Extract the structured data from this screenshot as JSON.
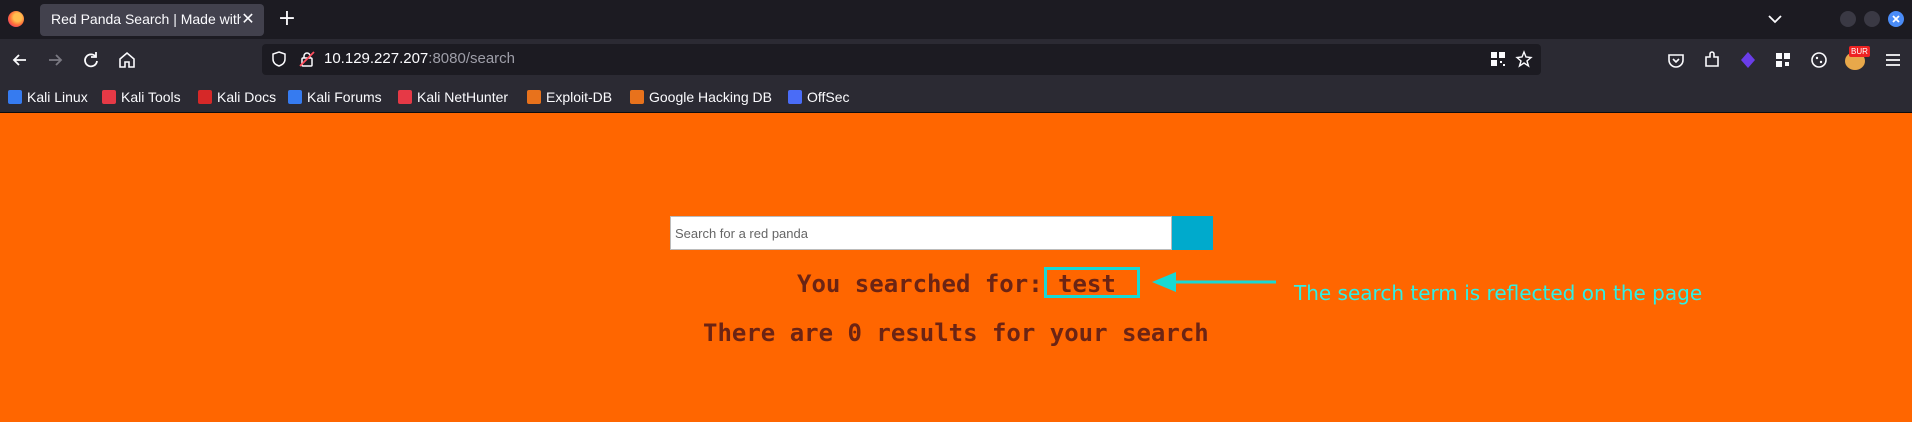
{
  "browser": {
    "tab": {
      "title": "Red Panda Search | Made with Spring Boot",
      "close_glyph": "✕"
    },
    "new_tab_glyph": "+",
    "url": {
      "host": "10.129.227.207",
      "rest": ":8080/search"
    },
    "extension_badge": "BUR",
    "bookmarks": [
      {
        "label": "Kali Linux",
        "icon_color": "#367bf0"
      },
      {
        "label": "Kali Tools",
        "icon_color": "#e63946"
      },
      {
        "label": "Kali Docs",
        "icon_color": "#d62828"
      },
      {
        "label": "Kali Forums",
        "icon_color": "#367bf0"
      },
      {
        "label": "Kali NetHunter",
        "icon_color": "#e63946"
      },
      {
        "label": "Exploit-DB",
        "icon_color": "#e8721c"
      },
      {
        "label": "Google Hacking DB",
        "icon_color": "#e8721c"
      },
      {
        "label": "OffSec",
        "icon_color": "#4a6cf7"
      }
    ]
  },
  "page": {
    "search": {
      "placeholder": "Search for a red panda",
      "value": ""
    },
    "searched_label": "You searched for:",
    "searched_term": "test",
    "results_text": "There are 0 results for your search",
    "annotation": "The search term is reflected on the page",
    "colors": {
      "background": "#ff6600",
      "text": "#6b2414",
      "accent": "#17d9d3",
      "button": "#00aacc"
    }
  }
}
